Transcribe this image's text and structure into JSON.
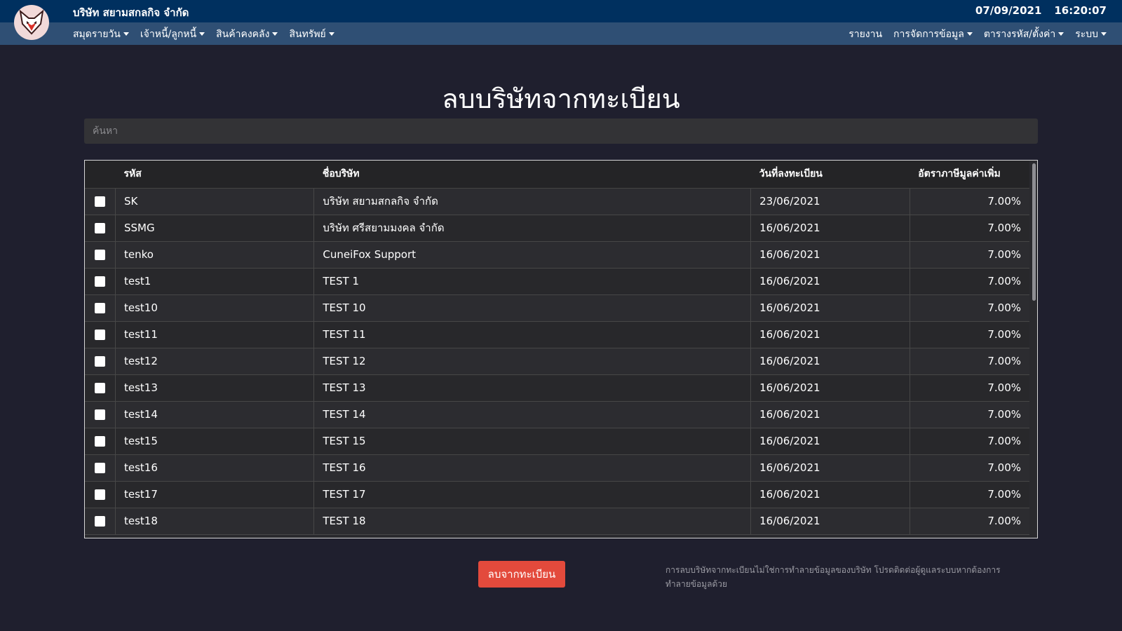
{
  "header": {
    "company_name": "บริษัท สยามสกลกิจ จำกัด",
    "date": "07/09/2021",
    "time": "16:20:07",
    "logo_icon": "fox-logo-icon"
  },
  "nav": {
    "left": [
      {
        "label": "สมุดรายวัน",
        "dropdown": true
      },
      {
        "label": "เจ้าหนี้/ลูกหนี้",
        "dropdown": true
      },
      {
        "label": "สินค้าคงคลัง",
        "dropdown": true
      },
      {
        "label": "สินทรัพย์",
        "dropdown": true
      }
    ],
    "right": [
      {
        "label": "รายงาน",
        "dropdown": false
      },
      {
        "label": "การจัดการข้อมูล",
        "dropdown": true
      },
      {
        "label": "ตารางรหัส/ตั้งค่า",
        "dropdown": true
      },
      {
        "label": "ระบบ",
        "dropdown": true
      }
    ]
  },
  "page": {
    "title": "ลบบริษัทจากทะเบียน"
  },
  "search": {
    "placeholder": "ค้นหา",
    "value": ""
  },
  "table": {
    "columns": [
      "",
      "รหัส",
      "ชื่อบริษัท",
      "วันที่ลงทะเบียน",
      "อัตราภาษีมูลค่าเพิ่ม"
    ],
    "rows": [
      {
        "checked": false,
        "code": "SK",
        "name": "บริษัท สยามสกลกิจ จำกัด",
        "date": "23/06/2021",
        "vat": "7.00%"
      },
      {
        "checked": false,
        "code": "SSMG",
        "name": "บริษัท ศรีสยามมงคล จำกัด",
        "date": "16/06/2021",
        "vat": "7.00%"
      },
      {
        "checked": false,
        "code": "tenko",
        "name": "CuneiFox Support",
        "date": "16/06/2021",
        "vat": "7.00%"
      },
      {
        "checked": false,
        "code": "test1",
        "name": "TEST 1",
        "date": "16/06/2021",
        "vat": "7.00%"
      },
      {
        "checked": false,
        "code": "test10",
        "name": "TEST 10",
        "date": "16/06/2021",
        "vat": "7.00%"
      },
      {
        "checked": false,
        "code": "test11",
        "name": "TEST 11",
        "date": "16/06/2021",
        "vat": "7.00%"
      },
      {
        "checked": false,
        "code": "test12",
        "name": "TEST 12",
        "date": "16/06/2021",
        "vat": "7.00%"
      },
      {
        "checked": false,
        "code": "test13",
        "name": "TEST 13",
        "date": "16/06/2021",
        "vat": "7.00%"
      },
      {
        "checked": false,
        "code": "test14",
        "name": "TEST 14",
        "date": "16/06/2021",
        "vat": "7.00%"
      },
      {
        "checked": false,
        "code": "test15",
        "name": "TEST 15",
        "date": "16/06/2021",
        "vat": "7.00%"
      },
      {
        "checked": false,
        "code": "test16",
        "name": "TEST 16",
        "date": "16/06/2021",
        "vat": "7.00%"
      },
      {
        "checked": false,
        "code": "test17",
        "name": "TEST 17",
        "date": "16/06/2021",
        "vat": "7.00%"
      },
      {
        "checked": false,
        "code": "test18",
        "name": "TEST 18",
        "date": "16/06/2021",
        "vat": "7.00%"
      }
    ]
  },
  "actions": {
    "delete_label": "ลบจากทะเบียน",
    "note": "การลบบริษัทจากทะเบียนไม่ใช่การทำลายข้อมูลของบริษัท โปรดติดต่อผู้ดูแลระบบหากต้องการทำลายข้อมูลด้วย"
  },
  "colors": {
    "topbar": "#00305f",
    "navbar": "#2f4f74",
    "background": "#1f1f2e",
    "danger": "#e34a3c"
  }
}
